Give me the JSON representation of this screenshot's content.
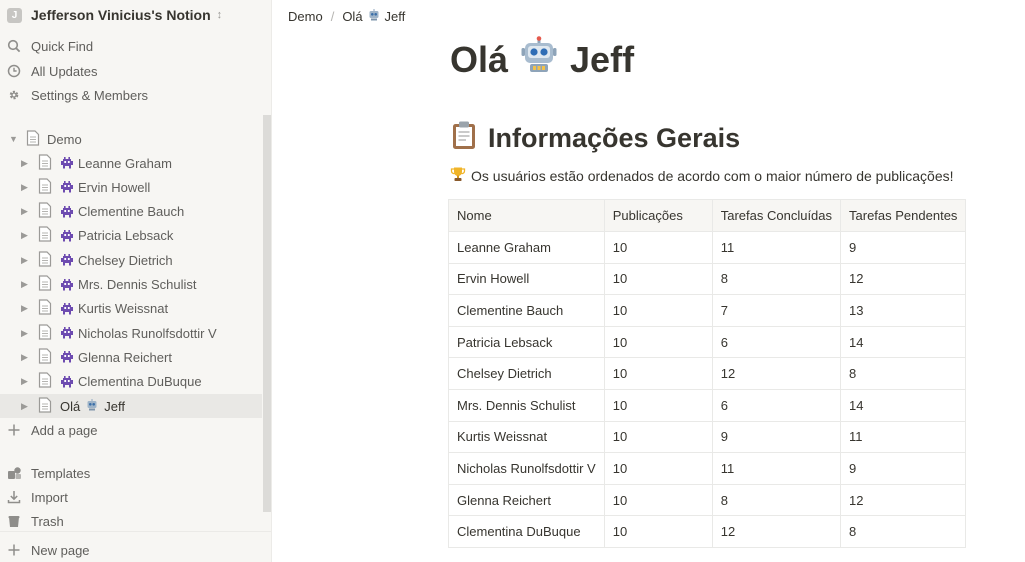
{
  "workspace": {
    "avatar_letter": "J",
    "name": "Jefferson Vinicius's Notion"
  },
  "sidebar": {
    "quick_find": "Quick Find",
    "all_updates": "All Updates",
    "settings": "Settings & Members",
    "root_page": "Demo",
    "pages": [
      "Leanne Graham",
      "Ervin Howell",
      "Clementine Bauch",
      "Patricia Lebsack",
      "Chelsey Dietrich",
      "Mrs. Dennis Schulist",
      "Kurtis Weissnat",
      "Nicholas Runolfsdottir V",
      "Glenna Reichert",
      "Clementina DuBuque"
    ],
    "active_page": {
      "prefix": "Olá",
      "suffix": "Jeff"
    },
    "add_page": "Add a page",
    "templates": "Templates",
    "import": "Import",
    "trash": "Trash",
    "new_page": "New page"
  },
  "breadcrumb": {
    "first": "Demo",
    "second_prefix": "Olá",
    "second_suffix": "Jeff"
  },
  "page": {
    "title_prefix": "Olá",
    "title_suffix": "Jeff",
    "heading": "Informações Gerais",
    "description": "Os usuários estão ordenados de acordo com o maior número de publicações!"
  },
  "table": {
    "headers": [
      "Nome",
      "Publicações",
      "Tarefas Concluídas",
      "Tarefas Pendentes"
    ],
    "rows": [
      [
        "Leanne Graham",
        "10",
        "11",
        "9"
      ],
      [
        "Ervin Howell",
        "10",
        "8",
        "12"
      ],
      [
        "Clementine Bauch",
        "10",
        "7",
        "13"
      ],
      [
        "Patricia Lebsack",
        "10",
        "6",
        "14"
      ],
      [
        "Chelsey Dietrich",
        "10",
        "12",
        "8"
      ],
      [
        "Mrs. Dennis Schulist",
        "10",
        "6",
        "14"
      ],
      [
        "Kurtis Weissnat",
        "10",
        "9",
        "11"
      ],
      [
        "Nicholas Runolfsdottir V",
        "10",
        "11",
        "9"
      ],
      [
        "Glenna Reichert",
        "10",
        "8",
        "12"
      ],
      [
        "Clementina DuBuque",
        "10",
        "12",
        "8"
      ]
    ]
  },
  "icons": {
    "page_emoji": "alien-monster-icon",
    "title_emoji": "robot-icon",
    "heading_emoji": "clipboard-icon",
    "description_emoji": "trophy-icon"
  }
}
